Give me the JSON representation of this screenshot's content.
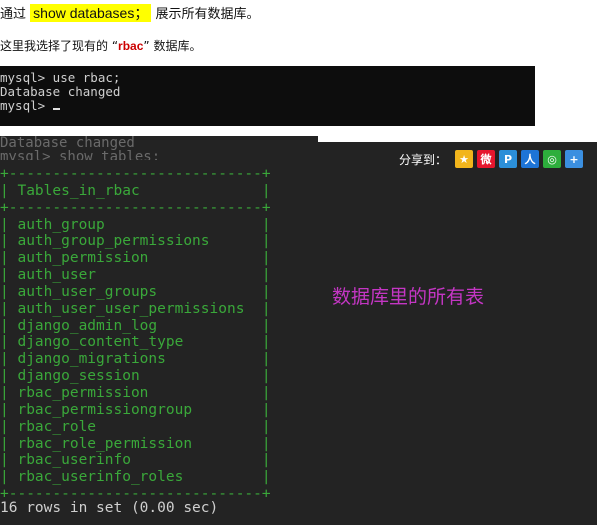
{
  "text": {
    "line1_prefix": "通过",
    "line1_highlight": "show databases；",
    "line1_suffix": "展示所有数据库。",
    "line2_prefix": "这里我选择了现有的 “",
    "line2_red": "rbac",
    "line2_suffix": "” 数据库。"
  },
  "terminal1": {
    "line1": "mysql> use rbac;",
    "line2": "Database changed",
    "line3": "mysql> "
  },
  "terminal2": {
    "ghost_line1": "Database changed",
    "ghost_line2": "mysql> show tables;",
    "share_label": "分享到：",
    "share_icons": [
      "qzone-icon",
      "weibo-icon",
      "pengyou-icon",
      "renren-icon",
      "wechat-icon",
      "plus-icon"
    ],
    "border_top": "+-----------------------------+",
    "header": "| Tables_in_rbac              |",
    "border_mid": "+-----------------------------+",
    "rows": [
      "| auth_group                  |",
      "| auth_group_permissions      |",
      "| auth_permission             |",
      "| auth_user                   |",
      "| auth_user_groups            |",
      "| auth_user_user_permissions  |",
      "| django_admin_log            |",
      "| django_content_type         |",
      "| django_migrations           |",
      "| django_session              |",
      "| rbac_permission             |",
      "| rbac_permissiongroup        |",
      "| rbac_role                   |",
      "| rbac_role_permission        |",
      "| rbac_userinfo               |",
      "| rbac_userinfo_roles         |"
    ],
    "border_bottom": "+-----------------------------+",
    "caption": "数据库里的所有表",
    "result": "16 rows in set (0.00 sec)"
  },
  "colors": {
    "highlight": "#ffff00",
    "red": "#cc0000",
    "terminal_green": "#3aa83a",
    "caption_magenta": "#c436c4"
  }
}
